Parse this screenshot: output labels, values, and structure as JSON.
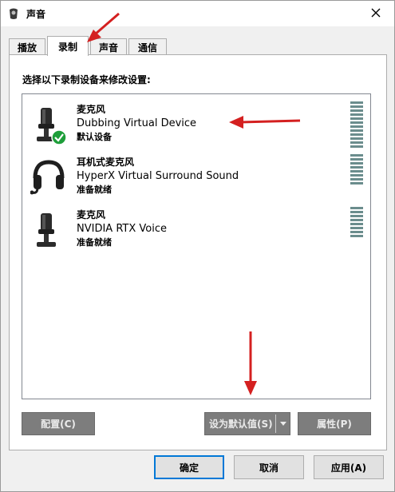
{
  "window": {
    "title": "声音",
    "app_icon": "speaker-icon",
    "close_icon": "close-icon"
  },
  "tabs": [
    {
      "label": "播放",
      "active": false
    },
    {
      "label": "录制",
      "active": true
    },
    {
      "label": "声音",
      "active": false
    },
    {
      "label": "通信",
      "active": false
    }
  ],
  "panel": {
    "instruction": "选择以下录制设备来修改设置:"
  },
  "devices": [
    {
      "name": "麦克风",
      "description": "Dubbing Virtual Device",
      "status": "默认设备",
      "icon": "microphone-icon",
      "is_default": true
    },
    {
      "name": "耳机式麦克风",
      "description": "HyperX Virtual Surround Sound",
      "status": "准备就绪",
      "icon": "headset-icon",
      "is_default": false
    },
    {
      "name": "麦克风",
      "description": "NVIDIA RTX Voice",
      "status": "准备就绪",
      "icon": "microphone-icon",
      "is_default": false
    }
  ],
  "panel_buttons": {
    "configure": "配置(C)",
    "set_default": "设为默认值(S)",
    "properties": "属性(P)"
  },
  "footer_buttons": {
    "ok": "确定",
    "cancel": "取消",
    "apply": "应用(A)"
  },
  "colors": {
    "annotation_arrow": "#d42020",
    "default_check": "#1e9e3a",
    "focus_border": "#0078d7"
  }
}
